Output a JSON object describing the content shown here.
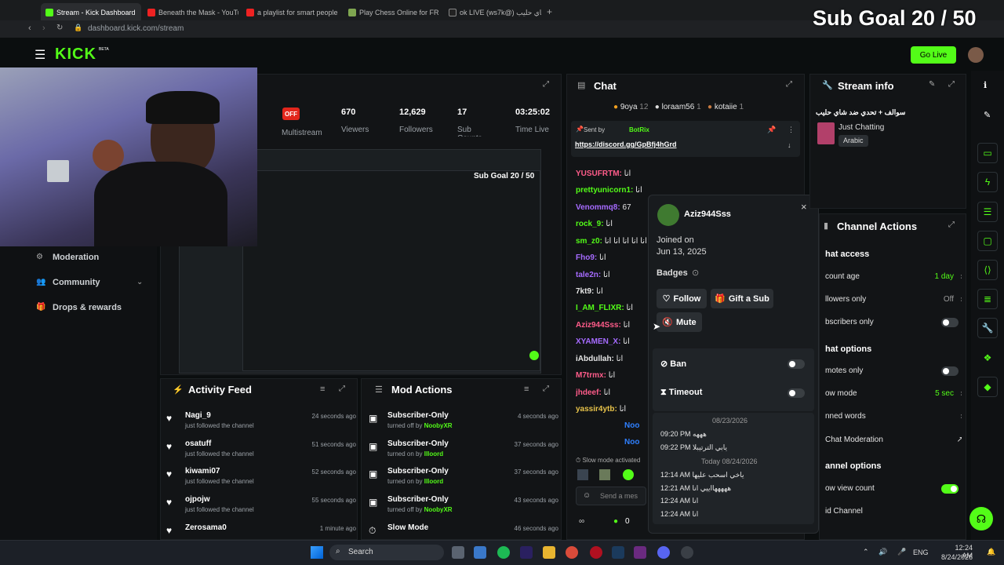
{
  "browser": {
    "tabs": [
      "Stream - Kick Dashboard",
      "Beneath the Mask - YouTube",
      "a playlist for smart people",
      "Play Chess Online for FREE",
      "ok LIVE (ws7k@) شاي حليب"
    ],
    "url": "dashboard.kick.com/stream"
  },
  "overlay": {
    "sub_goal": "Sub Goal 20 / 50"
  },
  "header": {
    "logo": "KICK",
    "beta": "BETA",
    "go_live": "Go Live"
  },
  "stats": {
    "off_badge": "OFF",
    "multistream": "Multistream",
    "viewers_value": "670",
    "viewers_label": "Viewers",
    "followers_value": "12,629",
    "followers_label": "Followers",
    "subs_value": "17",
    "subs_label": "Sub Counts",
    "time_value": "03:25:02",
    "time_label": "Time Live"
  },
  "sidebar": {
    "moderation": "Moderation",
    "community": "Community",
    "drops": "Drops & rewards"
  },
  "activity": {
    "title": "Activity Feed",
    "items": [
      {
        "name": "Nagi_9",
        "sub": "just followed the channel",
        "time": "24 seconds ago"
      },
      {
        "name": "osatuff",
        "sub": "just followed the channel",
        "time": "51 seconds ago"
      },
      {
        "name": "kiwami07",
        "sub": "just followed the channel",
        "time": "52 seconds ago"
      },
      {
        "name": "ojpojw",
        "sub": "just followed the channel",
        "time": "55 seconds ago"
      },
      {
        "name": "Zerosama0",
        "sub": "",
        "time": "1 minute ago"
      }
    ]
  },
  "mod_actions": {
    "title": "Mod Actions",
    "items": [
      {
        "name": "Subscriber-Only",
        "sub": "turned off by",
        "by": "NoobyXR",
        "time": "4 seconds ago"
      },
      {
        "name": "Subscriber-Only",
        "sub": "turned on by",
        "by": "Illoord",
        "time": "37 seconds ago"
      },
      {
        "name": "Subscriber-Only",
        "sub": "turned on by",
        "by": "Illoord",
        "time": "37 seconds ago"
      },
      {
        "name": "Subscriber-Only",
        "sub": "turned off by",
        "by": "NoobyXR",
        "time": "43 seconds ago"
      },
      {
        "name": "Slow Mode",
        "sub": "",
        "by": "",
        "time": "46 seconds ago"
      }
    ]
  },
  "chat": {
    "title": "Chat",
    "top_gifters": [
      {
        "name": "9oya",
        "count": "12"
      },
      {
        "name": "loraam56",
        "count": "1"
      },
      {
        "name": "kotaiie",
        "count": "1"
      }
    ],
    "pinned_by": "Sent by",
    "pinned_user": "BotRix",
    "pinned_link": "https://discord.gg/GpBfj4hGrd",
    "messages": [
      {
        "user": "YUSUFRTM:",
        "text": "انا",
        "color": "#ff5c8a"
      },
      {
        "user": "prettyunicorn1:",
        "text": "انا",
        "color": "#53fc18"
      },
      {
        "user": "Venommq8:",
        "text": "67",
        "color": "#a66bff"
      },
      {
        "user": "rock_9:",
        "text": "انا",
        "color": "#53fc18"
      },
      {
        "user": "sm_z0:",
        "text": "انا انا انا انا انا",
        "color": "#53fc18"
      },
      {
        "user": "Fho9:",
        "text": "انا",
        "color": "#a66bff"
      },
      {
        "user": "tale2n:",
        "text": "انا",
        "color": "#a66bff"
      },
      {
        "user": "7kt9:",
        "text": "انا",
        "color": "#e6e6e6"
      },
      {
        "user": "I_AM_FLIXR:",
        "text": "انا",
        "color": "#53fc18"
      },
      {
        "user": "Aziz944Sss:",
        "text": "انا",
        "color": "#ff5c8a"
      },
      {
        "user": "XYAMEN_X:",
        "text": "انا",
        "color": "#a66bff"
      },
      {
        "user": "iAbdullah:",
        "text": "انا",
        "color": "#e6e6e6"
      },
      {
        "user": "M7trmx:",
        "text": "انا",
        "color": "#ff5c8a"
      },
      {
        "user": "jhdeef:",
        "text": "انا",
        "color": "#ff5c8a"
      },
      {
        "user": "yassir4ytb:",
        "text": "انا",
        "color": "#e8c34a"
      },
      {
        "user": "Noo",
        "text": "",
        "color": "#2f80ff"
      },
      {
        "user": "Noo",
        "text": "",
        "color": "#2f80ff"
      }
    ],
    "slow_mode": "Slow mode activated",
    "input_placeholder": "Send a mes",
    "points": "0"
  },
  "user_card": {
    "username": "Aziz944Sss",
    "joined_label": "Joined on",
    "joined_date": "Jun 13, 2025",
    "badges_label": "Badges",
    "follow": "Follow",
    "gift": "Gift a Sub",
    "mute": "Mute",
    "ban": "Ban",
    "timeout": "Timeout",
    "log": [
      {
        "type": "date",
        "text": "08/23/2026"
      },
      {
        "type": "msg",
        "time": "09:20 PM",
        "text": "هههه"
      },
      {
        "type": "msg",
        "time": "09:22 PM",
        "text": "يابي الترتيبلا"
      },
      {
        "type": "date",
        "text": "Today 08/24/2026"
      },
      {
        "type": "msg",
        "time": "12:14 AM",
        "text": "ياخي اسحب عليها"
      },
      {
        "type": "msg",
        "time": "12:21 AM",
        "text": "هههههااييي انا"
      },
      {
        "type": "msg",
        "time": "12:24 AM",
        "text": "انا"
      },
      {
        "type": "msg",
        "time": "12:24 AM",
        "text": "انا"
      }
    ]
  },
  "stream_info": {
    "title": "Stream info",
    "stream_title": "سوالف + تحدي ضد شاي حليب",
    "category": "Just Chatting",
    "language": "Arabic"
  },
  "channel_actions": {
    "title": "Channel Actions",
    "chat_access": "hat access",
    "account_age": "count age",
    "account_age_value": "1 day",
    "followers_only": "llowers only",
    "followers_only_value": "Off",
    "subscribers_only": "bscribers only",
    "chat_options": "hat options",
    "emotes_only": "motes only",
    "slow_mode": "ow mode",
    "slow_mode_value": "5 sec",
    "banned_words": "nned words",
    "chat_moderation": "Chat Moderation",
    "channel_options": "annel options",
    "show_view_count": "ow view count",
    "raid_channel": "id Channel"
  },
  "taskbar": {
    "search": "Search",
    "lang": "ENG",
    "time": "12:24 AM",
    "date": "8/24/2026"
  }
}
